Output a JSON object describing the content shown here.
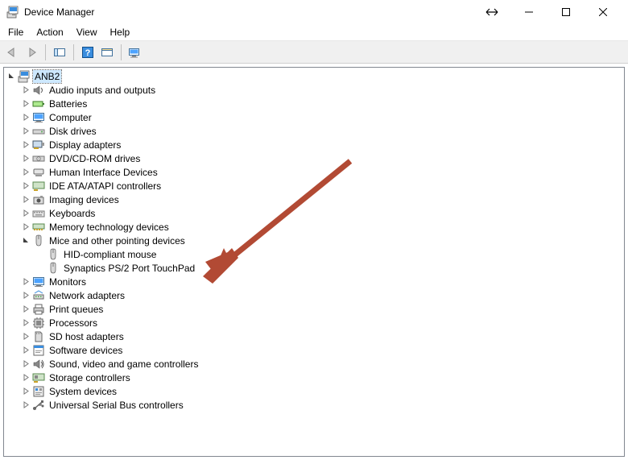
{
  "window": {
    "title": "Device Manager"
  },
  "menu": {
    "file": "File",
    "action": "Action",
    "view": "View",
    "help": "Help"
  },
  "toolbar_icons": {
    "back": "back-icon",
    "forward": "forward-icon",
    "show_hide": "show-hide-icon",
    "help": "help-icon",
    "scan": "scan-icon",
    "monitor": "monitor-icon"
  },
  "tree": {
    "root": {
      "label": "ANB2",
      "icon": "computer-root-icon",
      "expanded": true
    },
    "items": [
      {
        "label": "Audio inputs and outputs",
        "icon": "speaker-icon",
        "expanded": false
      },
      {
        "label": "Batteries",
        "icon": "battery-icon",
        "expanded": false
      },
      {
        "label": "Computer",
        "icon": "monitor-icon",
        "expanded": false
      },
      {
        "label": "Disk drives",
        "icon": "drive-icon",
        "expanded": false
      },
      {
        "label": "Display adapters",
        "icon": "display-adapter-icon",
        "expanded": false
      },
      {
        "label": "DVD/CD-ROM drives",
        "icon": "optical-drive-icon",
        "expanded": false
      },
      {
        "label": "Human Interface Devices",
        "icon": "hid-icon",
        "expanded": false
      },
      {
        "label": "IDE ATA/ATAPI controllers",
        "icon": "ide-icon",
        "expanded": false
      },
      {
        "label": "Imaging devices",
        "icon": "camera-icon",
        "expanded": false
      },
      {
        "label": "Keyboards",
        "icon": "keyboard-icon",
        "expanded": false
      },
      {
        "label": "Memory technology devices",
        "icon": "memory-icon",
        "expanded": false
      },
      {
        "label": "Mice and other pointing devices",
        "icon": "mouse-icon",
        "expanded": true,
        "children": [
          {
            "label": "HID-compliant mouse",
            "icon": "mouse-icon"
          },
          {
            "label": "Synaptics PS/2 Port TouchPad",
            "icon": "mouse-icon"
          }
        ]
      },
      {
        "label": "Monitors",
        "icon": "monitor-icon",
        "expanded": false
      },
      {
        "label": "Network adapters",
        "icon": "network-icon",
        "expanded": false
      },
      {
        "label": "Print queues",
        "icon": "printer-icon",
        "expanded": false
      },
      {
        "label": "Processors",
        "icon": "cpu-icon",
        "expanded": false
      },
      {
        "label": "SD host adapters",
        "icon": "sd-icon",
        "expanded": false
      },
      {
        "label": "Software devices",
        "icon": "software-icon",
        "expanded": false
      },
      {
        "label": "Sound, video and game controllers",
        "icon": "sound-icon",
        "expanded": false
      },
      {
        "label": "Storage controllers",
        "icon": "storage-icon",
        "expanded": false
      },
      {
        "label": "System devices",
        "icon": "system-icon",
        "expanded": false
      },
      {
        "label": "Universal Serial Bus controllers",
        "icon": "usb-icon",
        "expanded": false
      }
    ]
  },
  "annotation": {
    "arrow_color": "#b24a34"
  }
}
